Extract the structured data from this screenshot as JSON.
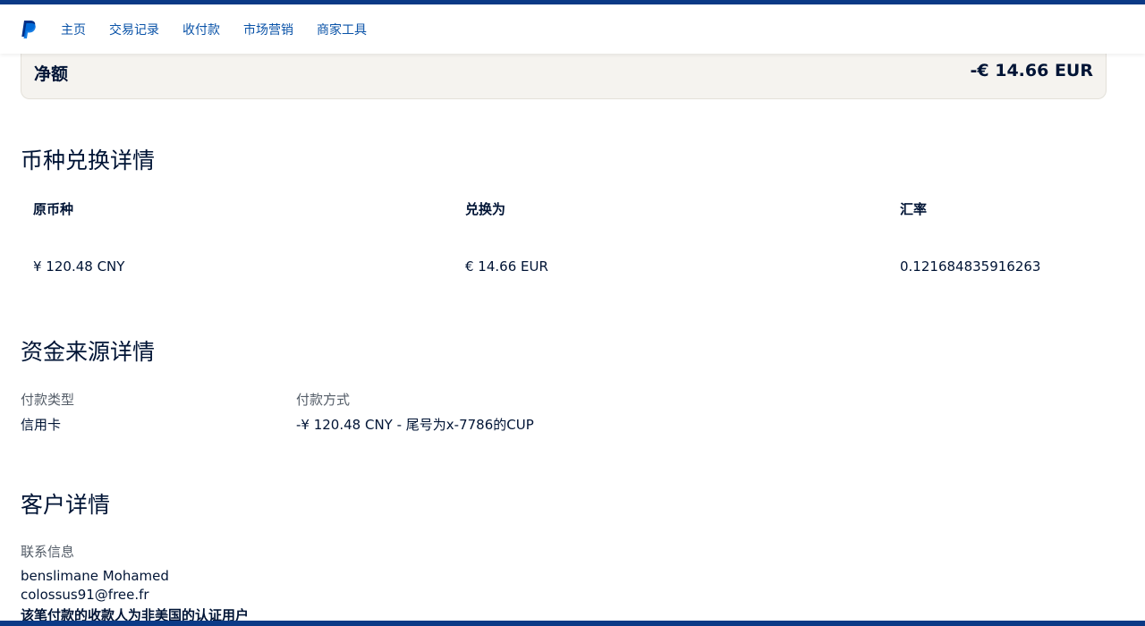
{
  "nav": {
    "logo": "paypal-logo",
    "items": [
      "主页",
      "交易记录",
      "收付款",
      "市场营销",
      "商家工具"
    ]
  },
  "net": {
    "label": "净额",
    "amount": "-€ 14.66 EUR"
  },
  "currency_conversion": {
    "title": "币种兑换详情",
    "headers": [
      "原币种",
      "兑换为",
      "汇率"
    ],
    "values": [
      "¥ 120.48 CNY",
      "€ 14.66 EUR",
      "0.121684835916263"
    ]
  },
  "funding": {
    "title": "资金来源详情",
    "type_label": "付款类型",
    "type_value": "信用卡",
    "method_label": "付款方式",
    "method_value": "-¥ 120.48 CNY - 尾号为x-7786的CUP"
  },
  "customer": {
    "title": "客户详情",
    "contact_label": "联系信息",
    "name": "benslimane Mohamed",
    "email": "colossus91@free.fr",
    "note": "该笔付款的收款人为非美国的认证用户"
  },
  "colors": {
    "accent": "#0a53a8",
    "stripe": "#0b3a86",
    "text": "#001435",
    "card_bg": "#f5f3ef"
  }
}
